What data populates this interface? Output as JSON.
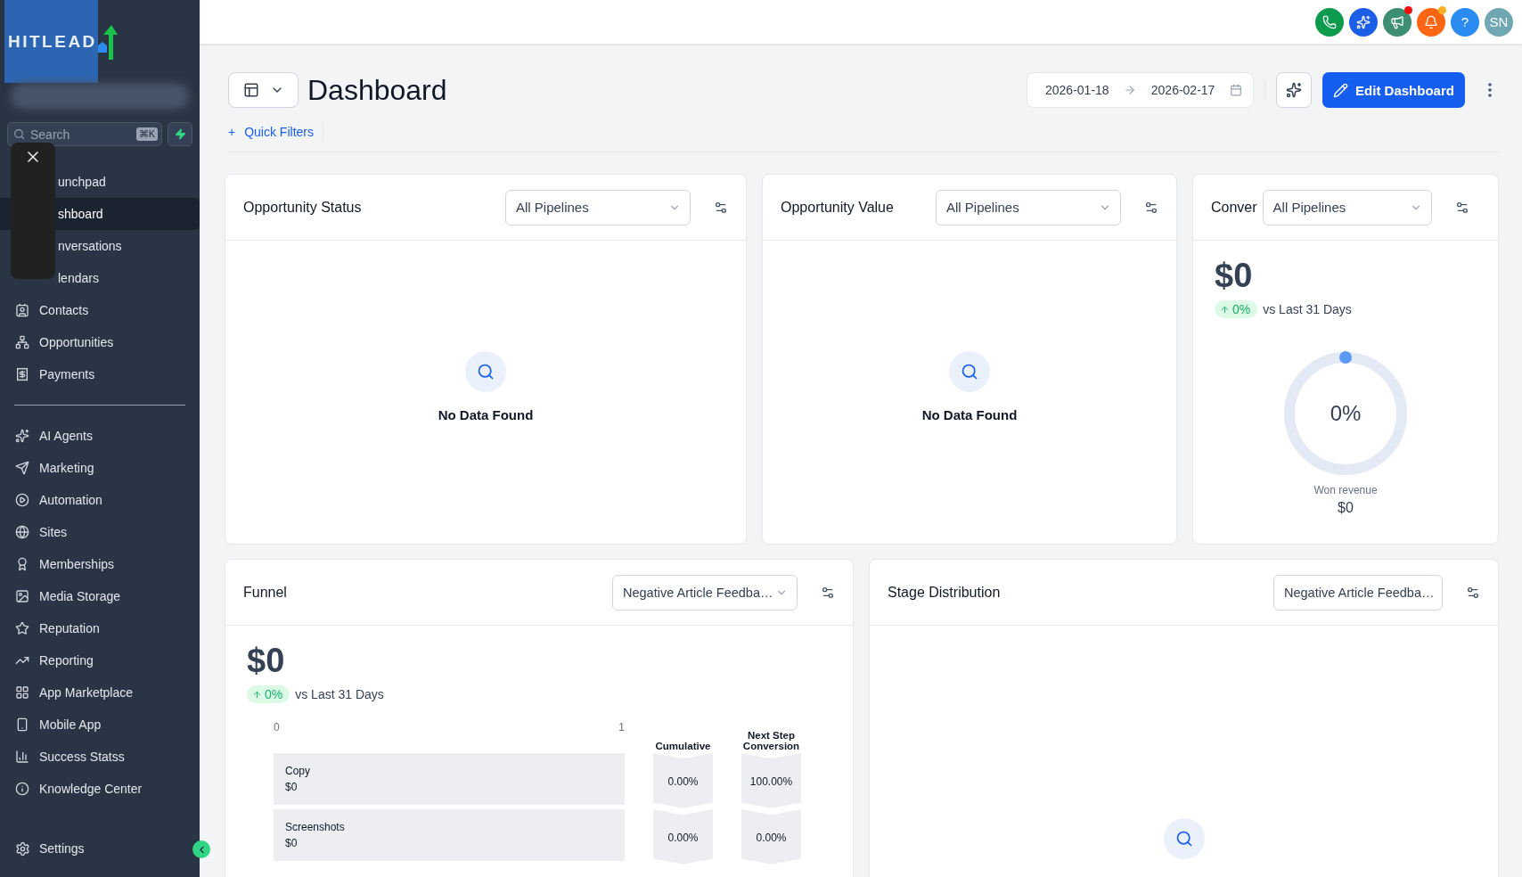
{
  "brand": {
    "logo_text": "HITLEAD"
  },
  "search": {
    "placeholder": "Search",
    "shortcut": "⌘K"
  },
  "sidebar": {
    "items": [
      {
        "label": "unchpad",
        "selected": false,
        "covered": true
      },
      {
        "label": "shboard",
        "selected": true,
        "covered": true
      },
      {
        "label": "nversations",
        "selected": false,
        "covered": true
      },
      {
        "label": "lendars",
        "selected": false,
        "covered": true
      },
      {
        "label": "Contacts",
        "selected": false
      },
      {
        "label": "Opportunities",
        "selected": false
      },
      {
        "label": "Payments",
        "selected": false
      }
    ],
    "items_2": [
      {
        "label": "AI Agents",
        "selected": false
      },
      {
        "label": "Marketing",
        "selected": false
      },
      {
        "label": "Automation",
        "selected": false
      },
      {
        "label": "Sites",
        "selected": false
      },
      {
        "label": "Memberships",
        "selected": false
      },
      {
        "label": "Media Storage",
        "selected": false
      },
      {
        "label": "Reputation",
        "selected": false
      },
      {
        "label": "Reporting",
        "selected": false
      },
      {
        "label": "App Marketplace",
        "selected": false
      },
      {
        "label": "Mobile App",
        "selected": false
      },
      {
        "label": "Success Statss",
        "selected": false
      },
      {
        "label": "Knowledge Center",
        "selected": false
      }
    ],
    "settings": "Settings"
  },
  "topbar": {
    "buttons": [
      {
        "kind": "phone",
        "color": "#0c9a4d"
      },
      {
        "kind": "sparkles",
        "color": "#1d5ee8"
      },
      {
        "kind": "megaphone",
        "color": "#3d8f74",
        "dot": {
          "color": "#f00f0f"
        }
      },
      {
        "kind": "bell",
        "color": "#fb6514",
        "dot": {
          "color": "#fdb022"
        }
      },
      {
        "kind": "help",
        "color": "#2a8bf2",
        "text": "?"
      },
      {
        "kind": "avatar",
        "color": "#6fa8b2",
        "text": "SN"
      }
    ]
  },
  "header": {
    "title": "Dashboard",
    "date_from": "2026-01-18",
    "date_to": "2026-02-17",
    "edit_button": "Edit Dashboard",
    "quick_filters": "Quick Filters",
    "plus": "+"
  },
  "widgets": [
    {
      "kind": "empty",
      "title": "Opportunity Status",
      "filter": "All Pipelines",
      "message": "No Data Found"
    },
    {
      "kind": "empty",
      "title": "Opportunity Value",
      "filter": "All Pipelines",
      "message": "No Data Found"
    },
    {
      "kind": "conversion",
      "title": "Conver",
      "filter": "All Pipelines",
      "amount": "$0",
      "change": "0%",
      "comparison": "vs Last 31 Days",
      "gauge_label": "0%",
      "level": 0,
      "caption": "Won revenue",
      "caption_value": "$0"
    }
  ],
  "widgets_2": [
    {
      "kind": "funnel",
      "title": "Funnel",
      "filter": "Negative Article Feedba…",
      "amount": "$0",
      "change": "0%",
      "comparison": "vs Last 31 Days",
      "axis_ticks": [
        "0",
        "1"
      ],
      "col_cumulative": "Cumulative",
      "col_next": "Next Step Conversion",
      "stages": [
        {
          "name": "Copy",
          "value": "$0",
          "cumulative": "0.00%",
          "next": "100.00%"
        },
        {
          "name": "Screenshots",
          "value": "$0",
          "cumulative": "0.00%",
          "next": "0.00%"
        }
      ]
    },
    {
      "kind": "blank",
      "title": "Stage Distribution",
      "filter": "Negative Article Feedba…"
    }
  ]
}
